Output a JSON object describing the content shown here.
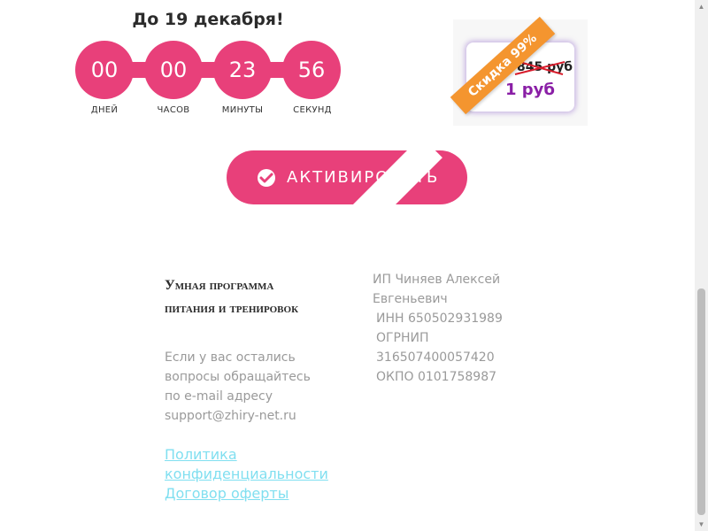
{
  "countdown": {
    "title": "До 19 декабря!",
    "days": "00",
    "hours": "00",
    "minutes": "23",
    "seconds": "56",
    "days_label": "ДНЕЙ",
    "hours_label": "ЧАСОВ",
    "minutes_label": "МИНУТЫ",
    "seconds_label": "СЕКУНД"
  },
  "promo": {
    "ribbon": "Скидка 99%",
    "old_price": "845 руб",
    "new_price": "1 руб"
  },
  "cta": {
    "label": "АКТИВИРОВАТЬ",
    "icon": "check-icon"
  },
  "footer": {
    "title": "Умная программа питания и тренировок",
    "contact_text": "Если у вас остались вопросы обращайтесь по e-mail адресу support@zhiry-net.ru",
    "privacy_link": "Политика конфиденциальности",
    "offer_link": "Договор оферты",
    "company_name": "ИП Чиняев Алексей Евгеньевич",
    "inn": "ИНН 650502931989",
    "ogrnip_label": "ОГРНИП",
    "ogrnip": "316507400057420",
    "okpo": "ОКПО 0101758987"
  },
  "colors": {
    "accent": "#e8407a",
    "link": "#80dff0",
    "ribbon": "#f4952f",
    "price": "#8a1fa6"
  }
}
